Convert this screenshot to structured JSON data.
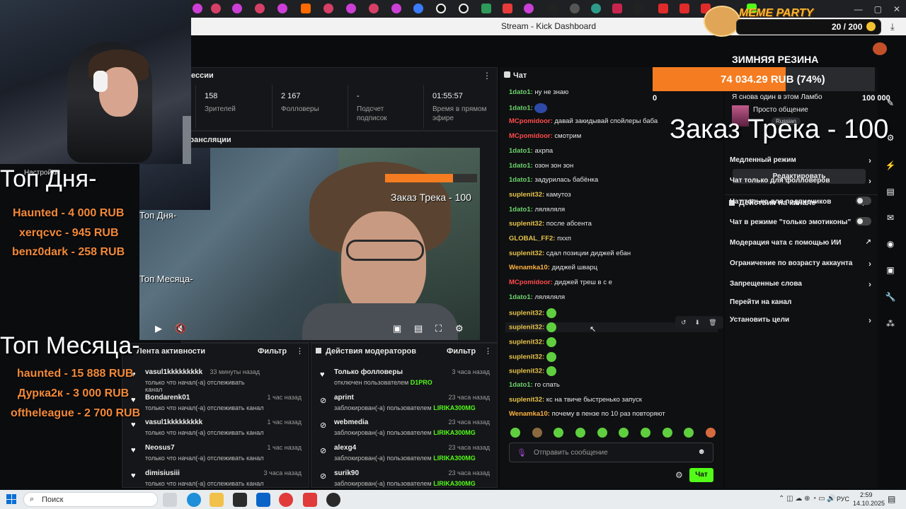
{
  "window": {
    "title": "Stream - Kick Dashboard"
  },
  "overlay": {
    "top_day_title": "Топ Дня-",
    "top_day": [
      "Haunted - 4 000 RUB",
      "xerqcvc - 945 RUB",
      "benz0dark - 258 RUB"
    ],
    "top_month_title": "Топ Месяца-",
    "top_month": [
      "haunted - 15 888 RUB",
      "Дурка2к - 3 000 RUB",
      "oftheleague - 2 700 RUB"
    ],
    "meme_party": "MEME PARTY",
    "counter": "20 / 200",
    "goal_title": "ЗИМНЯЯ РЕЗИНА",
    "goal_value": "74 034.29 RUB (74%)",
    "goal_progress": 0.74,
    "goal_min": "0",
    "goal_max": "100 000",
    "track_order": "Заказ Трека - 100"
  },
  "dashboard": {
    "session_title": "ессии",
    "settings_label": "Настройки",
    "stats": [
      {
        "value": "158",
        "label": "Зрителей"
      },
      {
        "value": "2 167",
        "label": "Фолловеры"
      },
      {
        "value": "-",
        "label": "Подсчет подписок"
      },
      {
        "value": "01:55:57",
        "label": "Время в прямом эфире"
      }
    ],
    "broadcast_title": "трансляции",
    "activity_title": "Лента активности",
    "filter_label": "Фильтр",
    "activity": [
      {
        "name": "vasul1kkkkkkkkk",
        "sub": "только что начал(-а) отслеживать канал",
        "time": "33 минуты назад"
      },
      {
        "name": "Bondarenk01",
        "sub": "только что начал(-а) отслеживать канал",
        "time": "1 час назад"
      },
      {
        "name": "vasul1kkkkkkkkk",
        "sub": "только что начал(-а) отслеживать канал",
        "time": "1 час назад"
      },
      {
        "name": "Neosus7",
        "sub": "только что начал(-а) отслеживать канал",
        "time": "1 час назад"
      },
      {
        "name": "dimisiusiii",
        "sub": "только что начал(-а) отслеживать канал",
        "time": "3 часа назад"
      }
    ],
    "mod_title": "Действия модераторов",
    "mod_actions": [
      {
        "name": "Только фолловеры",
        "sub": "отключен пользователем",
        "by": "D1PRO",
        "time": "3 часа назад"
      },
      {
        "name": "aprint",
        "sub": "заблокирован(-а) пользователем",
        "by": "LIRIKA300MG",
        "time": "23 часа назад"
      },
      {
        "name": "webmedia",
        "sub": "заблокирован(-а) пользователем",
        "by": "LIRIKA300MG",
        "time": "23 часа назад"
      },
      {
        "name": "alexg4",
        "sub": "заблокирован(-а) пользователем",
        "by": "LIRIKA300MG",
        "time": "23 часа назад"
      },
      {
        "name": "surik90",
        "sub": "заблокирован(-а) пользователем",
        "by": "LIRIKA300MG",
        "time": "23 часа назад"
      }
    ]
  },
  "chat": {
    "title": "Чат",
    "messages": [
      {
        "user": "1dato1:",
        "color": "green",
        "text": "ну не знаю"
      },
      {
        "user": "1dato1:",
        "color": "green",
        "text": ""
      },
      {
        "user": "MCpomidoor:",
        "color": "red",
        "text": "давай закидывай спойлеры баба"
      },
      {
        "user": "MCpomidoor:",
        "color": "red",
        "text": "смотрим"
      },
      {
        "user": "1dato1:",
        "color": "green",
        "text": "ахрпа"
      },
      {
        "user": "1dato1:",
        "color": "green",
        "text": "озон зон зон"
      },
      {
        "user": "1dato1:",
        "color": "green",
        "text": "задурилась бабёнка"
      },
      {
        "user": "suplenit32:",
        "color": "yellow",
        "text": "камутоз"
      },
      {
        "user": "1dato1:",
        "color": "green",
        "text": "ляляляля"
      },
      {
        "user": "suplenit32:",
        "color": "yellow",
        "text": "после абсента"
      },
      {
        "user": "GLOBAL_FF2:",
        "color": "yellow",
        "text": "пххп"
      },
      {
        "user": "suplenit32:",
        "color": "yellow",
        "text": "сдал позиции диджей ебан"
      },
      {
        "user": "Wenamka10:",
        "color": "orange",
        "text": "диджей шварц"
      },
      {
        "user": "MCpomidoor:",
        "color": "red",
        "text": "диджей треш в с е"
      },
      {
        "user": "1dato1:",
        "color": "green",
        "text": "ляляляля"
      },
      {
        "user": "suplenit32:",
        "color": "yellow",
        "text": ""
      },
      {
        "user": "suplenit32:",
        "color": "yellow",
        "text": ""
      },
      {
        "user": "suplenit32:",
        "color": "yellow",
        "text": ""
      },
      {
        "user": "suplenit32:",
        "color": "yellow",
        "text": ""
      },
      {
        "user": "suplenit32:",
        "color": "yellow",
        "text": ""
      },
      {
        "user": "1dato1:",
        "color": "green",
        "text": "го спать"
      },
      {
        "user": "suplenit32:",
        "color": "yellow",
        "text": "кс на твиче быстренько запуск"
      },
      {
        "user": "Wenamka10:",
        "color": "orange",
        "text": "почему в пензе по 10 раз повторяют"
      }
    ],
    "input_placeholder": "Отправить сообщение",
    "send_label": "Чат"
  },
  "stream_info": {
    "title": "Я снова один в этом Ламбо",
    "category": "Просто общение",
    "tag": "Russian",
    "edit_label": "Редактировать"
  },
  "channel_actions": {
    "title": "Действия на канале",
    "items": [
      {
        "label": "Медленный режим",
        "control": "chevron"
      },
      {
        "label": "Чат только для фолловеров",
        "control": "chevron"
      },
      {
        "label": "Чат только для подписчиков",
        "control": "toggle"
      },
      {
        "label": "Чат в режиме \"только эмотиконы\"",
        "control": "toggle"
      },
      {
        "label": "Модерация чата с помощью ИИ",
        "control": "external"
      },
      {
        "label": "Ограничение по возрасту аккаунта",
        "control": "chevron"
      },
      {
        "label": "Запрещенные слова",
        "control": "chevron"
      },
      {
        "label": "Перейти на канал",
        "control": "none"
      },
      {
        "label": "Установить цели",
        "control": "chevron"
      }
    ]
  },
  "taskbar": {
    "search": "Поиск",
    "lang": "РУС",
    "time": "2:59",
    "date": "14.10.2025"
  },
  "colors": {
    "accent": "#53fc18",
    "goal_bar": "#f57c20",
    "overlay_orange": "#f2893a"
  }
}
